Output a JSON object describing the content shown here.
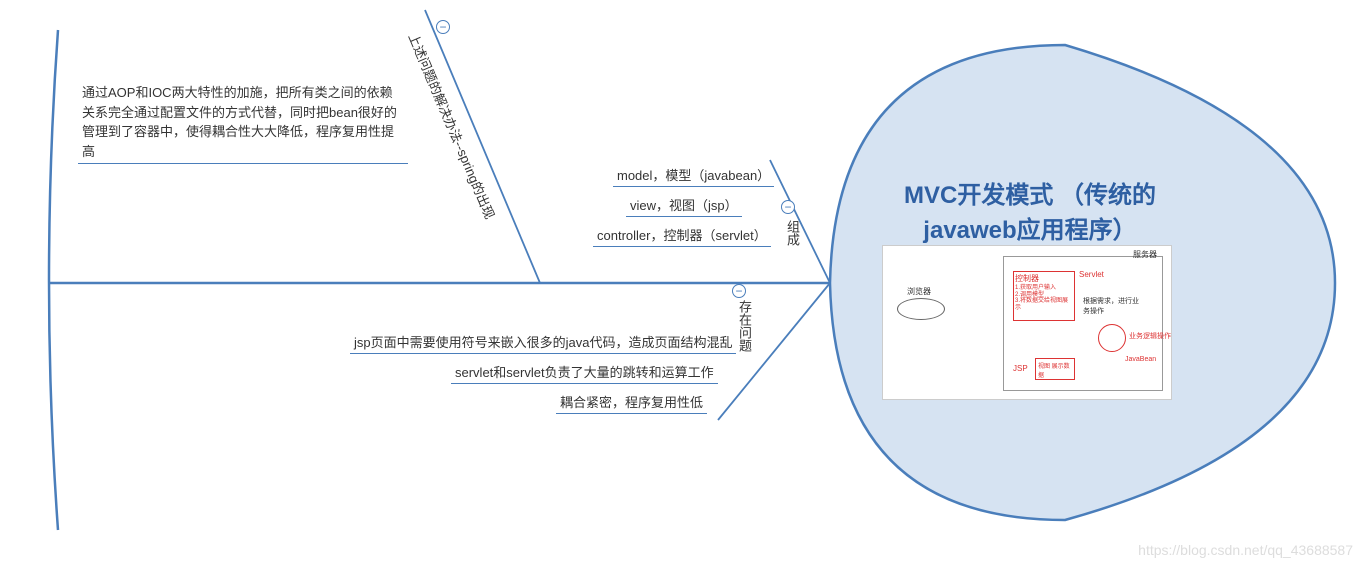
{
  "head": {
    "title": "MVC开发模式 （传统的javaweb应用程序）"
  },
  "branches": {
    "solution": {
      "label": "上述问题的解决办法--spring的出现",
      "items": [
        "通过AOP和IOC两大特性的加施，把所有类之间的依赖关系完全通过配置文件的方式代替，同时把bean很好的管理到了容器中，使得耦合性大大降低，程序复用性提高"
      ]
    },
    "composition": {
      "label": "组成",
      "items": [
        "model，模型（javabean）",
        "view，视图（jsp）",
        "controller，控制器（servlet）"
      ]
    },
    "problems": {
      "label": "存在问题",
      "items": [
        "jsp页面中需要使用符号来嵌入很多的java代码，造成页面结构混乱",
        "servlet和servlet负责了大量的跳转和运算工作",
        "耦合紧密，程序复用性低"
      ]
    }
  },
  "embedded": {
    "browser_label": "浏览器",
    "server_label": "服务器",
    "controller": "控制器",
    "controller_sub": "1.获取用户输入\n2.调用模型\n3.将数据交给视图展示",
    "servlet": "Servlet",
    "model_label": "根据需求，进行业务操作",
    "view_label": "JSP",
    "view_sub": "视图 展示数据",
    "javabean": "JavaBean",
    "logic_label": "业务逻辑操作"
  },
  "watermark": "https://blog.csdn.net/qq_43688587"
}
